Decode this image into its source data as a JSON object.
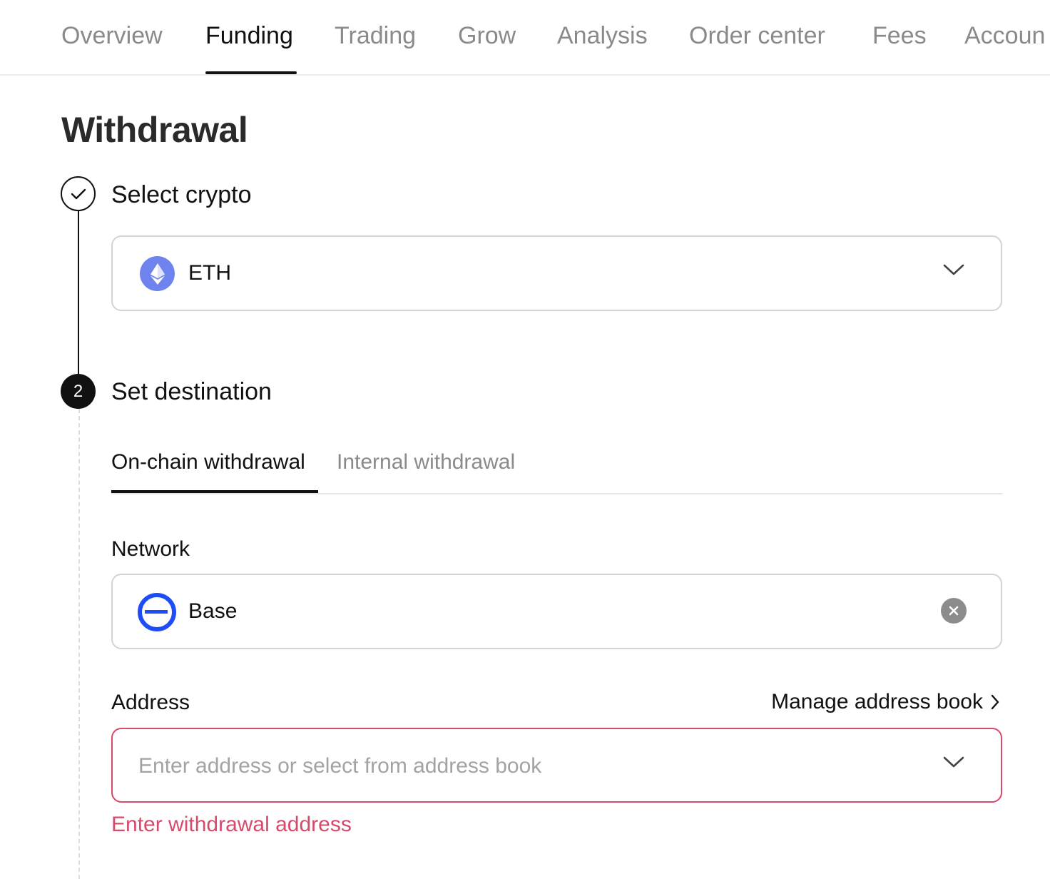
{
  "nav": {
    "tabs": [
      {
        "label": "Overview"
      },
      {
        "label": "Funding"
      },
      {
        "label": "Trading"
      },
      {
        "label": "Grow"
      },
      {
        "label": "Analysis"
      },
      {
        "label": "Order center"
      },
      {
        "label": "Fees"
      },
      {
        "label": "Accoun"
      }
    ],
    "active_tab": "Funding"
  },
  "page": {
    "title": "Withdrawal"
  },
  "steps": [
    {
      "status": "completed",
      "title": "Select crypto",
      "selected_crypto": "ETH",
      "icon": "eth-icon"
    },
    {
      "status": "current",
      "number": "2",
      "title": "Set destination"
    }
  ],
  "withdrawal_tabs": [
    {
      "label": "On-chain withdrawal"
    },
    {
      "label": "Internal withdrawal"
    }
  ],
  "active_withdrawal_tab": "On-chain withdrawal",
  "network": {
    "label": "Network",
    "value": "Base",
    "icon": "base-network-icon"
  },
  "address": {
    "label": "Address",
    "manage_link": "Manage address book",
    "value": "",
    "placeholder": "Enter address or select from address book",
    "error": "Enter withdrawal address"
  },
  "colors": {
    "error": "#d64a6b",
    "eth_icon_bg": "#6f83ef",
    "base_icon": "#1f4df5",
    "active_text": "#111111",
    "inactive_text": "#8a8a8a"
  }
}
